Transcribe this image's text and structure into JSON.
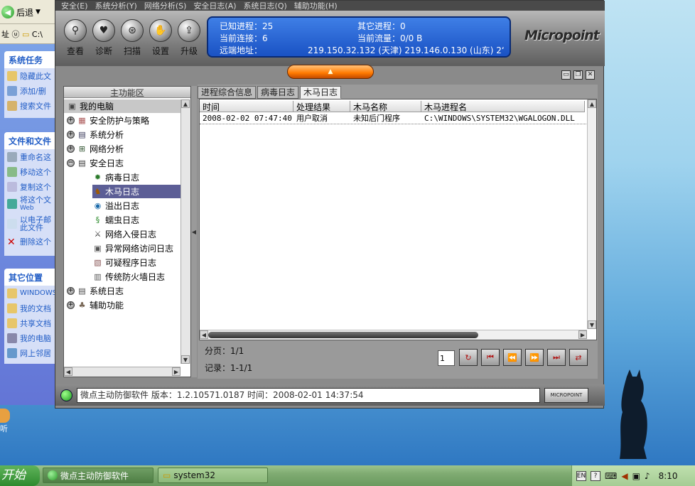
{
  "explorer": {
    "back_label": "后退",
    "addr_label": "址 ⓤ",
    "addr_value": "C:\\",
    "system_tasks_title": "系统任务",
    "system_tasks": [
      "隐藏此文",
      "添加/删",
      "搜索文件"
    ],
    "file_tasks_title": "文件和文件",
    "file_tasks": [
      "重命名这",
      "移动这个",
      "复制这个",
      "将这个文",
      "以电子邮",
      "删除这个"
    ],
    "file_tasks_sub": {
      "web": "Web",
      "mail": "此文件"
    },
    "other_title": "其它位置",
    "other": [
      "WINDOWS",
      "我的文档",
      "共享文档",
      "我的电脑",
      "网上邻居"
    ]
  },
  "app": {
    "menu": [
      "安全(E)",
      "系统分析(Y)",
      "网络分析(S)",
      "安全日志(A)",
      "系统日志(Q)",
      "辅助功能(H)"
    ],
    "tools": [
      {
        "label": "查看",
        "icon": "magnifier-icon",
        "glyph": "⚲"
      },
      {
        "label": "诊断",
        "icon": "heart-pulse-icon",
        "glyph": "♥"
      },
      {
        "label": "扫描",
        "icon": "scan-icon",
        "glyph": "⊛"
      },
      {
        "label": "设置",
        "icon": "hand-icon",
        "glyph": "✋"
      },
      {
        "label": "升级",
        "icon": "upgrade-icon",
        "glyph": "⇪"
      }
    ],
    "info": {
      "known_proc_label": "已知进程：25",
      "other_proc_label": "其它进程：0",
      "conn_label": "当前连接：6",
      "traffic_label": "当前流量：0/0 B",
      "remote_label": "远端地址：",
      "remote_value": "219.150.32.132 (天津)   219.146.0.130 (山东)   2‘"
    },
    "logo": "Micropoint",
    "left_panel_title": "主功能区",
    "tree": [
      {
        "label": "我的电脑",
        "level": 0,
        "icon": "computer-icon",
        "glyph": "▣",
        "color": "#444",
        "expander": "",
        "selected": false,
        "header": true
      },
      {
        "label": "安全防护与策略",
        "level": 0,
        "icon": "shield-policy-icon",
        "glyph": "▦",
        "color": "#a55",
        "expander": "+",
        "selected": false
      },
      {
        "label": "系统分析",
        "level": 0,
        "icon": "system-analysis-icon",
        "glyph": "▤",
        "color": "#335",
        "expander": "+",
        "selected": false
      },
      {
        "label": "网络分析",
        "level": 0,
        "icon": "network-icon",
        "glyph": "⊞",
        "color": "#353",
        "expander": "+",
        "selected": false
      },
      {
        "label": "安全日志",
        "level": 0,
        "icon": "log-icon",
        "glyph": "▤",
        "color": "#333",
        "expander": "−",
        "selected": false
      },
      {
        "label": "病毒日志",
        "level": 1,
        "icon": "virus-icon",
        "glyph": "✹",
        "color": "#2a7a2a",
        "expander": "",
        "selected": false
      },
      {
        "label": "木马日志",
        "level": 1,
        "icon": "trojan-horse-icon",
        "glyph": "♞",
        "color": "#a05a00",
        "expander": "",
        "selected": true
      },
      {
        "label": "溢出日志",
        "level": 1,
        "icon": "overflow-icon",
        "glyph": "◉",
        "color": "#1a6aaa",
        "expander": "",
        "selected": false
      },
      {
        "label": "蠕虫日志",
        "level": 1,
        "icon": "worm-icon",
        "glyph": "§",
        "color": "#2a8a2a",
        "expander": "",
        "selected": false
      },
      {
        "label": "网络入侵日志",
        "level": 1,
        "icon": "sword-icon",
        "glyph": "⚔",
        "color": "#333",
        "expander": "",
        "selected": false
      },
      {
        "label": "异常网络访问日志",
        "level": 1,
        "icon": "abnormal-net-icon",
        "glyph": "▣",
        "color": "#555",
        "expander": "",
        "selected": false
      },
      {
        "label": "可疑程序日志",
        "level": 1,
        "icon": "suspicious-prog-icon",
        "glyph": "▧",
        "color": "#855",
        "expander": "",
        "selected": false
      },
      {
        "label": "传统防火墙日志",
        "level": 1,
        "icon": "firewall-icon",
        "glyph": "▥",
        "color": "#555",
        "expander": "",
        "selected": false
      },
      {
        "label": "系统日志",
        "level": 0,
        "icon": "system-log-icon",
        "glyph": "▤",
        "color": "#444",
        "expander": "+",
        "selected": false
      },
      {
        "label": "辅助功能",
        "level": 0,
        "icon": "assist-icon",
        "glyph": "♣",
        "color": "#765",
        "expander": "+",
        "selected": false
      }
    ],
    "tabs": [
      {
        "label": "进程综合信息",
        "active": false
      },
      {
        "label": "病毒日志",
        "active": false
      },
      {
        "label": "木马日志",
        "active": true
      }
    ],
    "columns": [
      {
        "label": "时间",
        "width": 132
      },
      {
        "label": "处理结果",
        "width": 80
      },
      {
        "label": "木马名称",
        "width": 100
      },
      {
        "label": "木马进程名",
        "width": 230
      }
    ],
    "rows": [
      [
        "2008-02-02 07:47:40",
        "用户取消",
        "未知后门程序",
        "C:\\WINDOWS\\SYSTEM32\\WGALOGON.DLL"
      ]
    ],
    "pager": {
      "page_label": "分页：1/1",
      "record_label": "记录：1-1/1",
      "page_input": "1",
      "buttons": [
        {
          "name": "refresh-button",
          "icon": "refresh-icon",
          "glyph": "↻"
        },
        {
          "name": "first-page-button",
          "icon": "first-page-icon",
          "glyph": "⏮"
        },
        {
          "name": "prev-page-button",
          "icon": "prev-page-icon",
          "glyph": "⏪"
        },
        {
          "name": "next-page-button",
          "icon": "next-page-icon",
          "glyph": "⏩"
        },
        {
          "name": "last-page-button",
          "icon": "last-page-icon",
          "glyph": "⏭"
        },
        {
          "name": "export-button",
          "icon": "export-icon",
          "glyph": "⇄"
        }
      ]
    },
    "status": "微点主动防御软件      版本：1.2.10571.0187      时间：2008-02-01 14:37:54",
    "status_badge": "MICROPOINT"
  },
  "desktop_icon_label": "听",
  "taskbar": {
    "start": "开始",
    "tasks": [
      {
        "label": "微点主动防御软件",
        "icon": "micropoint-task-icon"
      },
      {
        "label": "system32",
        "icon": "folder-icon"
      }
    ],
    "tray": {
      "lang": "EN",
      "help": "?",
      "time": "8:10"
    }
  }
}
